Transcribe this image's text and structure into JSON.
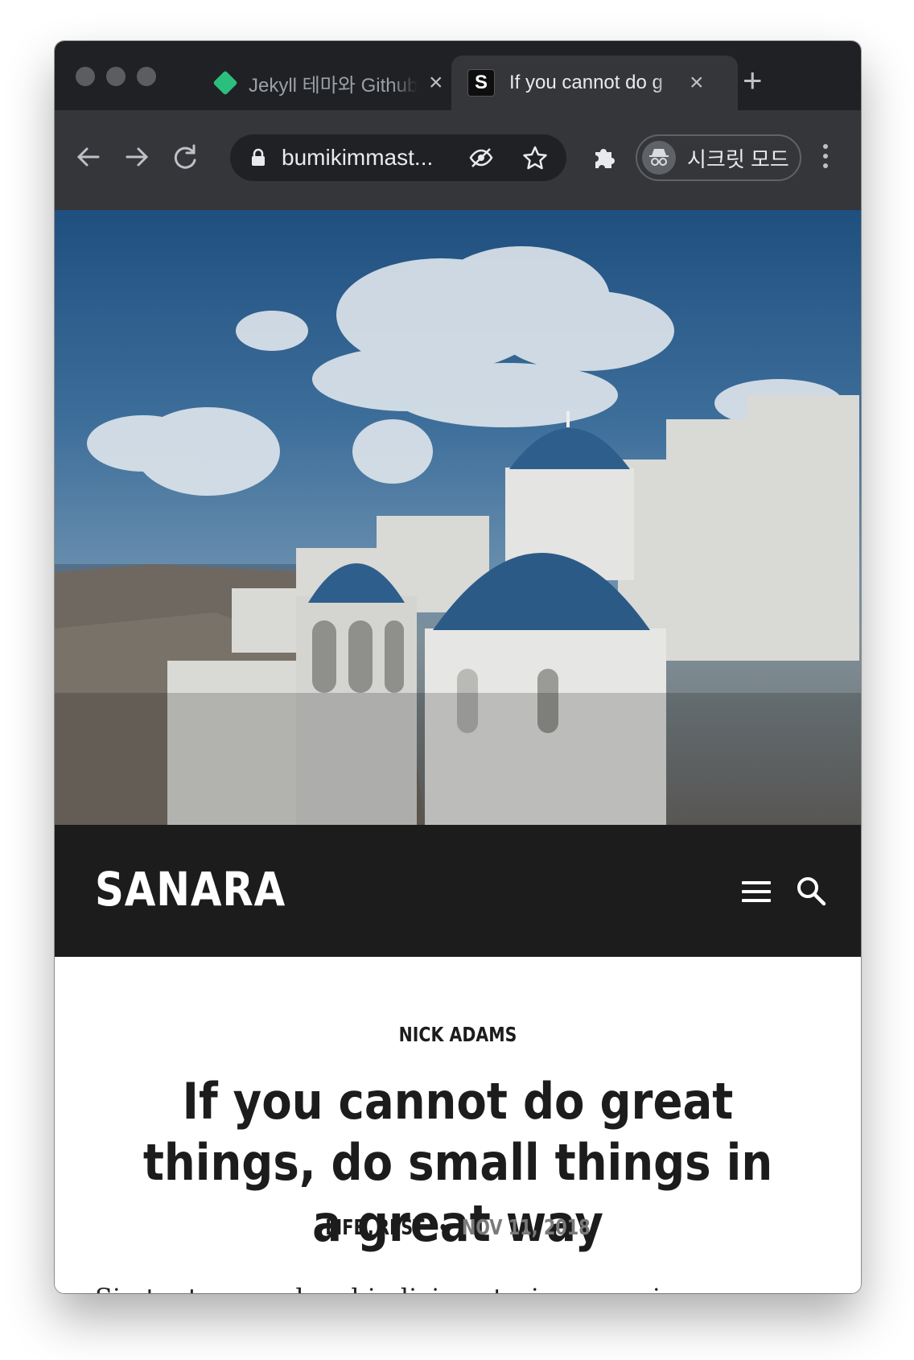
{
  "browser": {
    "tabs": [
      {
        "title": "Jekyll 테마와 Github",
        "favicon": "green-diamond-icon",
        "active": false
      },
      {
        "title": "If you cannot do g",
        "favicon": "s-logo-icon",
        "active": true
      }
    ],
    "address_bar": {
      "url": "bumikimmast..."
    },
    "incognito_label": "시크릿 모드"
  },
  "site": {
    "logo": "SANARA"
  },
  "post": {
    "author": "NICK ADAMS",
    "title": "If you cannot do great things, do small things in a great way",
    "categories": [
      "LIFE",
      "REST"
    ],
    "date": "NOV 11, 2018",
    "excerpt": "Sin tantum modo ad indicia veteris memoriae"
  },
  "colors": {
    "tabstrip": "#202124",
    "toolbar": "#35363a",
    "site_header": "#1c1c1d",
    "favicon_green": "#2bbf7e",
    "date_gray": "#7a7a7a"
  }
}
